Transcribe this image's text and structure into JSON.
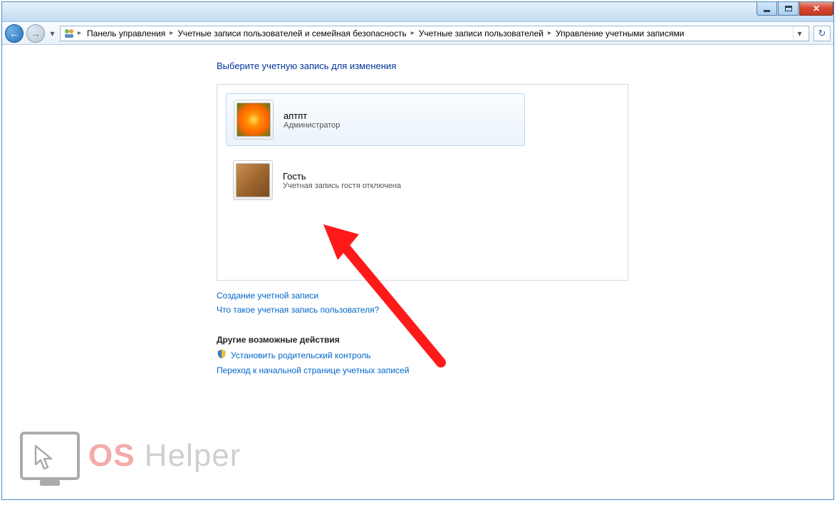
{
  "breadcrumb": {
    "items": [
      "Панель управления",
      "Учетные записи пользователей и семейная безопасность",
      "Учетные записи пользователей",
      "Управление учетными записями"
    ]
  },
  "page": {
    "title": "Выберите учетную запись для изменения"
  },
  "accounts": [
    {
      "name": "аптпт",
      "role": "Администратор"
    },
    {
      "name": "Гость",
      "role": "Учетная запись гостя отключена"
    }
  ],
  "links": {
    "create_account": "Создание учетной записи",
    "what_is_account": "Что такое учетная запись пользователя?"
  },
  "other_actions": {
    "heading": "Другие возможные действия",
    "parental": "Установить родительский контроль",
    "goto_main": "Переход к начальной странице учетных записей"
  },
  "watermark": {
    "os": "OS",
    "helper": " Helper"
  }
}
